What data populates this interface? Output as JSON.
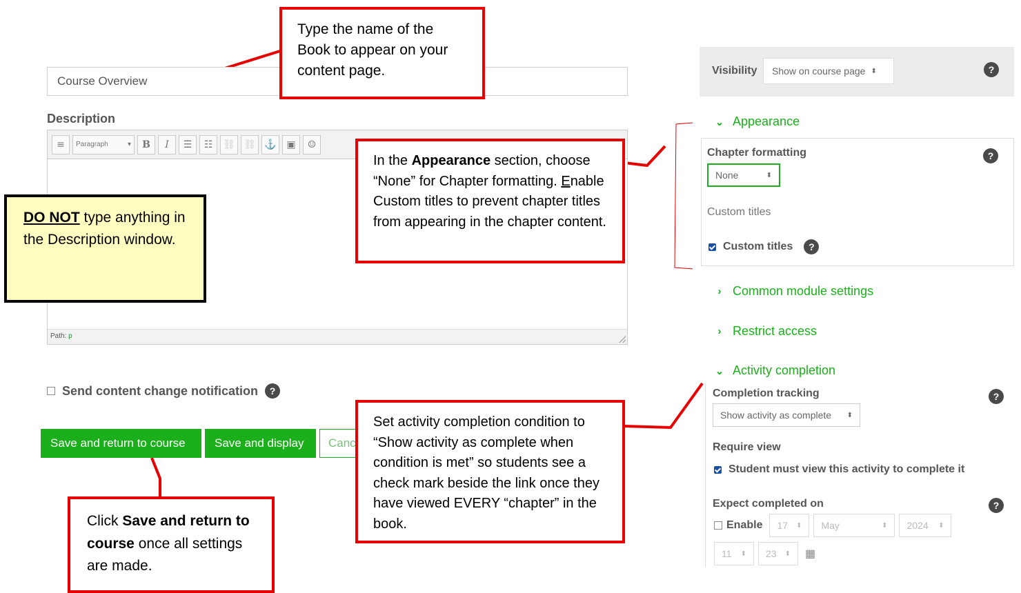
{
  "form": {
    "name_value": "Course Overview",
    "description_label": "Description",
    "toolbar": {
      "paragraph_select": "Paragraph",
      "bold": "B",
      "italic": "I"
    },
    "path_label": "Path:",
    "path_value": "p",
    "notify_label": "Send content change notification",
    "help_glyph": "?",
    "buttons": {
      "save_return": "Save and return to course",
      "save_display": "Save and display",
      "cancel": "Cancel"
    }
  },
  "right": {
    "visibility_label": "Visibility",
    "visibility_value": "Show on course page",
    "appearance_header": "Appearance",
    "chapter_formatting_label": "Chapter formatting",
    "chapter_formatting_value": "None",
    "custom_titles_label": "Custom titles",
    "custom_titles_checkbox": "Custom titles",
    "common_module_header": "Common module settings",
    "restrict_access_header": "Restrict access",
    "activity_completion_header": "Activity completion",
    "completion_tracking_label": "Completion tracking",
    "completion_tracking_value": "Show activity as complete",
    "require_view_label": "Require view",
    "require_view_checkbox": "Student must view this activity to complete it",
    "expect_completed_label": "Expect completed on",
    "enable_label": "Enable",
    "date": {
      "day": "17",
      "month": "May",
      "year": "2024",
      "hour": "11",
      "minute": "23"
    }
  },
  "callouts": {
    "name": "Type the name of the Book to appear on your content page.",
    "description_bold": "DO NOT",
    "description_rest": " type anything in the Description window.",
    "appearance_pre": "In the ",
    "appearance_bold": "Appearance",
    "appearance_mid": " section, choose “None” for Chapter formatting. ",
    "appearance_underlined": "E",
    "appearance_post": "nable Custom titles to prevent chapter titles from appearing in the chapter content.",
    "completion": "Set activity completion condition to “Show activity as complete when condition is met” so students see a check mark beside the link once they have viewed EVERY “chapter” in the book.",
    "save_pre": "Click ",
    "save_bold": "Save and return to course",
    "save_post": " once all settings are made."
  },
  "colors": {
    "accent_green": "#1bb01b",
    "callout_red": "#e60000",
    "note_yellow": "#fffdc0"
  }
}
